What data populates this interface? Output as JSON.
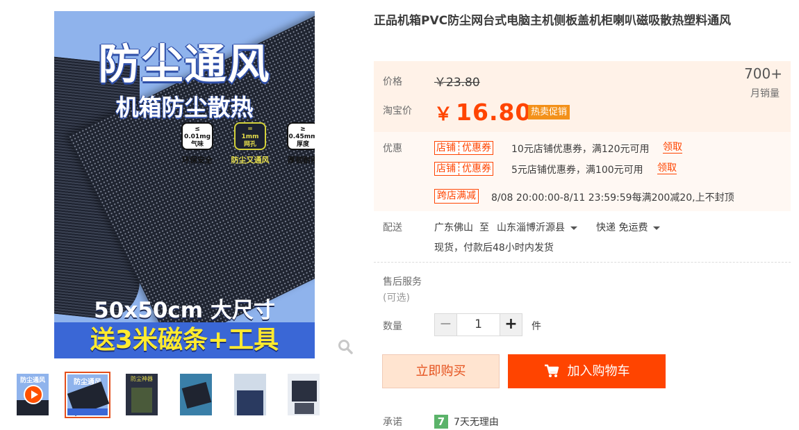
{
  "gallery": {
    "main_image": {
      "headline": "防尘通风",
      "subheadline": "机箱防尘散热",
      "specs": [
        {
          "symbol": "≤",
          "value": "0.01mg",
          "unit": "气味",
          "caption": "环保安全"
        },
        {
          "symbol": "=",
          "value": "1mm",
          "unit": "网孔",
          "caption": "防尘又通风"
        },
        {
          "symbol": "≥",
          "value": "0.45mm",
          "unit": "厚度",
          "caption": "厚韧耐用"
        }
      ],
      "size_text": "50x50cm 大尺寸",
      "gift_text": "送3米磁条+工具"
    },
    "thumbs": [
      {
        "label": "防尘通风",
        "has_video": true
      },
      {
        "label": "防尘通风",
        "selected": true
      },
      {
        "label": "防尘神器"
      },
      {
        "label": ""
      },
      {
        "label": ""
      },
      {
        "label": ""
      }
    ]
  },
  "product": {
    "title": "正品机箱PVC防尘网台式电脑主机侧板盖机柜喇叭磁吸散热塑料通风"
  },
  "price": {
    "original_label": "价格",
    "original_price": "￥23.80",
    "taobao_label": "淘宝价",
    "currency": "￥",
    "current_price": "16.80",
    "badge": "热卖促销",
    "monthly_sales": "700+",
    "monthly_sales_label": "月销量"
  },
  "promotions": {
    "label": "优惠",
    "coupons": [
      {
        "tag_left": "店铺",
        "tag_right": "优惠券",
        "text": "10元店铺优惠券，满120元可用",
        "action": "领取"
      },
      {
        "tag_left": "店铺",
        "tag_right": "优惠券",
        "text": "5元店铺优惠券，满100元可用",
        "action": "领取"
      }
    ],
    "cross_store": {
      "tag": "跨店满减",
      "text": "8/08 20:00:00-8/11 23:59:59每满200减20,上不封顶"
    }
  },
  "delivery": {
    "label": "配送",
    "from": "广东佛山",
    "to_word": "至",
    "to": "山东淄博沂源县",
    "method": "快递 免运费",
    "note": "现货，付款后48小时内发货"
  },
  "after_sales": {
    "label": "售后服务",
    "optional": "(可选)"
  },
  "quantity": {
    "label": "数量",
    "minus": "−",
    "value": "1",
    "plus": "+",
    "unit": "件"
  },
  "actions": {
    "buy_now": "立即购买",
    "add_to_cart": "加入购物车"
  },
  "promise": {
    "label": "承诺",
    "icon_text": "7",
    "text": "7天无理由"
  },
  "colors": {
    "accent": "#ff4400",
    "price_bg": "#fff2e8",
    "badge": "#f3911a"
  }
}
